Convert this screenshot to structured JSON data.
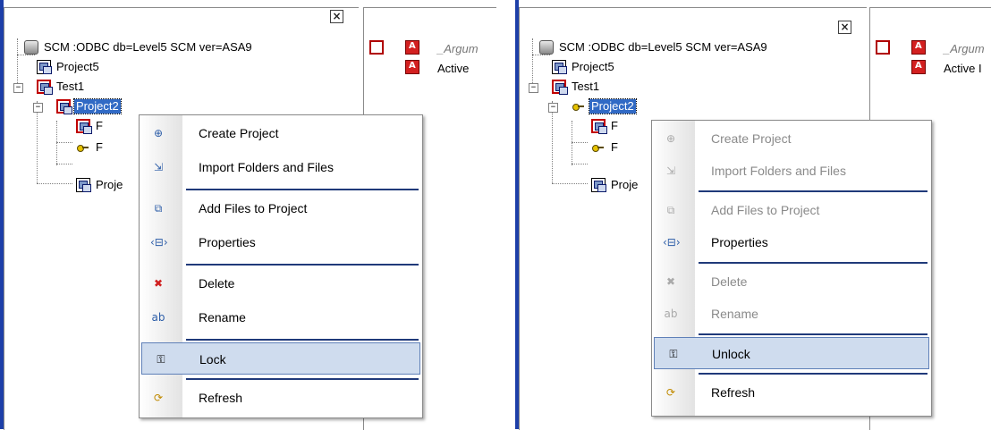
{
  "panels": [
    {
      "tree": {
        "root": "SCM :ODBC db=Level5 SCM ver=ASA9",
        "project5": "Project5",
        "test1": "Test1",
        "project2": "Project2",
        "child1": "F",
        "child2": "F",
        "proje": "Proje"
      },
      "list": {
        "item1": "_Argum",
        "item2": "Active"
      },
      "menu": [
        {
          "label": "Create Project",
          "icon": "create-project-icon",
          "glyph": "⊕"
        },
        {
          "label": "Import Folders and Files",
          "icon": "import-icon",
          "glyph": "⇲"
        },
        {
          "label": "Add Files to Project",
          "icon": "add-files-icon",
          "glyph": "⧉"
        },
        {
          "label": "Properties",
          "icon": "properties-icon",
          "glyph": "‹⊟›"
        },
        {
          "label": "Delete",
          "icon": "delete-icon",
          "glyph": "✖"
        },
        {
          "label": "Rename",
          "icon": "rename-icon",
          "glyph": "ab"
        },
        {
          "label": "Lock",
          "icon": "lock-key-icon",
          "glyph": "⚿"
        },
        {
          "label": "Refresh",
          "icon": "refresh-icon",
          "glyph": "⟳"
        }
      ]
    },
    {
      "tree": {
        "root": "SCM :ODBC db=Level5 SCM ver=ASA9",
        "project5": "Project5",
        "test1": "Test1",
        "project2": "Project2",
        "child1": "F",
        "child2": "F",
        "proje": "Proje"
      },
      "list": {
        "item1": "_Argum",
        "item2": "Active I"
      },
      "menu": [
        {
          "label": "Create Project",
          "icon": "create-project-icon",
          "glyph": "⊕"
        },
        {
          "label": "Import Folders and Files",
          "icon": "import-icon",
          "glyph": "⇲"
        },
        {
          "label": "Add Files to Project",
          "icon": "add-files-icon",
          "glyph": "⧉"
        },
        {
          "label": "Properties",
          "icon": "properties-icon",
          "glyph": "‹⊟›"
        },
        {
          "label": "Delete",
          "icon": "delete-icon",
          "glyph": "✖"
        },
        {
          "label": "Rename",
          "icon": "rename-icon",
          "glyph": "ab"
        },
        {
          "label": "Unlock",
          "icon": "unlock-key-icon",
          "glyph": "⚿"
        },
        {
          "label": "Refresh",
          "icon": "refresh-icon",
          "glyph": "⟳"
        }
      ]
    }
  ],
  "close_glyph": "×",
  "colors": {
    "selection": "#316ac5",
    "menu_highlight": "#cfdcee",
    "separator": "#203a7a",
    "lock_red": "#c00000"
  }
}
